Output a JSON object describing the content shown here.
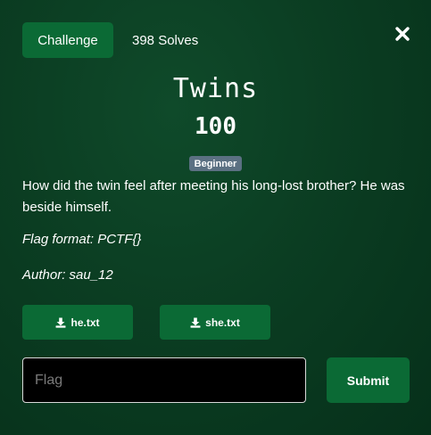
{
  "header": {
    "tabs": [
      {
        "label": "Challenge",
        "active": true
      },
      {
        "label": "398 Solves",
        "active": false
      }
    ],
    "close_icon": "close-icon"
  },
  "challenge": {
    "name": "Twins",
    "points": "100",
    "difficulty": "Beginner",
    "description": "How did the twin feel after meeting his long-lost brother? He was beside himself.",
    "flag_format": "Flag format: PCTF{}",
    "author": "Author: sau_12"
  },
  "files": [
    {
      "label": "he.txt",
      "icon": "download-icon"
    },
    {
      "label": "she.txt",
      "icon": "download-icon"
    }
  ],
  "submission": {
    "placeholder": "Flag",
    "value": "",
    "submit_label": "Submit"
  },
  "colors": {
    "background": "#0b3d22",
    "accent": "#0b6a35",
    "badge": "#5b7082",
    "input_bg": "#000000"
  }
}
